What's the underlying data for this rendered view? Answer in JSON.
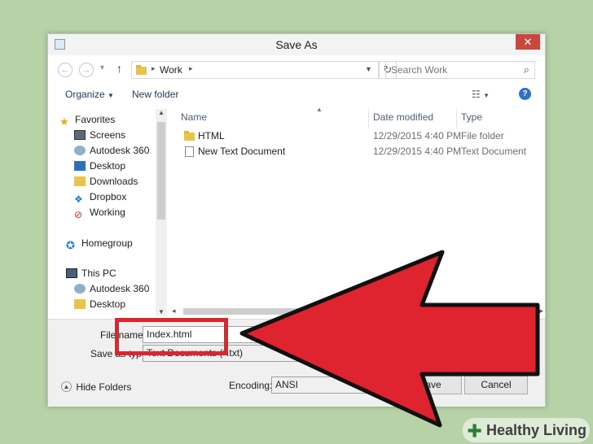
{
  "window": {
    "title": "Save As",
    "close_symbol": "✕"
  },
  "address": {
    "back_symbol": "←",
    "forward_symbol": "→",
    "up_symbol": "↑",
    "path": "Work",
    "refresh_symbol": "↻",
    "search_placeholder": "Search Work",
    "search_symbol": "⌕"
  },
  "toolbar": {
    "organize": "Organize",
    "new_folder": "New folder",
    "help": "?"
  },
  "nav": {
    "favorites": "Favorites",
    "favorites_items": [
      "Screens",
      "Autodesk 360",
      "Desktop",
      "Downloads",
      "Dropbox",
      "Working"
    ],
    "homegroup": "Homegroup",
    "this_pc": "This PC",
    "pc_items": [
      "Autodesk 360",
      "Desktop"
    ]
  },
  "columns": {
    "name": "Name",
    "date": "Date modified",
    "type": "Type"
  },
  "files": [
    {
      "name": "HTML",
      "date": "12/29/2015 4:40 PM",
      "type": "File folder"
    },
    {
      "name": "New Text Document",
      "date": "12/29/2015 4:40 PM",
      "type": "Text Document"
    }
  ],
  "bottom": {
    "file_name_label": "File name:",
    "file_name_value": "Index.html",
    "save_type_label": "Save as type:",
    "save_type_value": "Text Documents (*.txt)",
    "hide_folders": "Hide Folders",
    "encoding_label": "Encoding:",
    "encoding_value": "ANSI",
    "save_button": "Save",
    "cancel_button": "Cancel"
  },
  "watermark": {
    "brand": "Healthy Living"
  },
  "colors": {
    "arrow": "#e0242f",
    "highlight": "#e0242f",
    "background": "#b6d2a6"
  }
}
